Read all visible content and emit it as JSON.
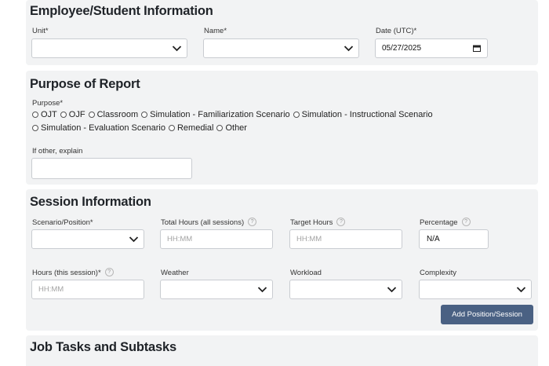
{
  "employee": {
    "title": "Employee/Student Information",
    "unit_label": "Unit*",
    "name_label": "Name*",
    "date_label": "Date (UTC)*",
    "date_value": "05/27/2025"
  },
  "purpose": {
    "title": "Purpose of Report",
    "purpose_label": "Purpose*",
    "options": [
      "OJT",
      "OJF",
      "Classroom",
      "Simulation - Familiarization Scenario",
      "Simulation - Instructional Scenario",
      "Simulation - Evaluation Scenario",
      "Remedial",
      "Other"
    ],
    "other_label": "If other, explain"
  },
  "session": {
    "title": "Session Information",
    "scenario_label": "Scenario/Position*",
    "total_hours_label": "Total Hours (all sessions)",
    "total_hours_placeholder": "HH:MM",
    "target_hours_label": "Target Hours",
    "target_hours_placeholder": "HH:MM",
    "percentage_label": "Percentage",
    "percentage_value": "N/A",
    "hours_session_label": "Hours (this session)*",
    "hours_session_placeholder": "HH:MM",
    "weather_label": "Weather",
    "workload_label": "Workload",
    "complexity_label": "Complexity",
    "add_button": "Add Position/Session",
    "help_glyph": "?"
  },
  "tasks": {
    "title": "Job Tasks and Subtasks"
  },
  "icons": {
    "chevron": "chevron-down-icon",
    "calendar": "calendar-icon",
    "help": "help-circle-icon"
  }
}
